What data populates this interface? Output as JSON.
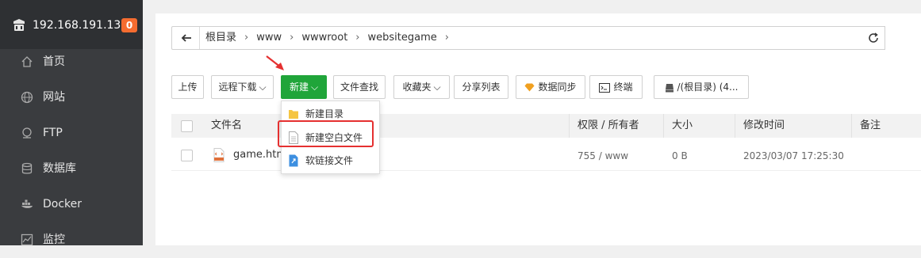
{
  "server": {
    "ip": "192.168.191.130",
    "badge": "0"
  },
  "sidebar": {
    "items": [
      {
        "label": "首页",
        "icon": "home-icon"
      },
      {
        "label": "网站",
        "icon": "globe-icon"
      },
      {
        "label": "FTP",
        "icon": "ftp-icon"
      },
      {
        "label": "数据库",
        "icon": "database-icon"
      },
      {
        "label": "Docker",
        "icon": "docker-icon"
      },
      {
        "label": "监控",
        "icon": "monitor-icon"
      }
    ]
  },
  "breadcrumb": [
    "根目录",
    "www",
    "wwwroot",
    "websitegame"
  ],
  "toolbar": {
    "upload": "上传",
    "remote_download": "远程下载",
    "new": "新建",
    "file_search": "文件查找",
    "favorites": "收藏夹",
    "share_list": "分享列表",
    "data_sync": "数据同步",
    "terminal": "终端",
    "disk": "/(根目录) (4..."
  },
  "new_menu": {
    "items": [
      {
        "label": "新建目录",
        "icon": "folder-icon"
      },
      {
        "label": "新建空白文件",
        "icon": "blank-file-icon"
      },
      {
        "label": "软链接文件",
        "icon": "symlink-icon"
      }
    ]
  },
  "table": {
    "headers": {
      "name": "文件名",
      "perm": "权限 / 所有者",
      "size": "大小",
      "mtime": "修改时间",
      "note": "备注"
    },
    "rows": [
      {
        "name": "game.html",
        "perm": "755 / www",
        "size": "0 B",
        "mtime": "2023/03/07 17:25:30"
      }
    ]
  },
  "colors": {
    "accent_green": "#20a53a",
    "sidebar_bg": "#3a3c3f",
    "highlight_red": "#e53030",
    "badge_orange": "#f56c30"
  }
}
